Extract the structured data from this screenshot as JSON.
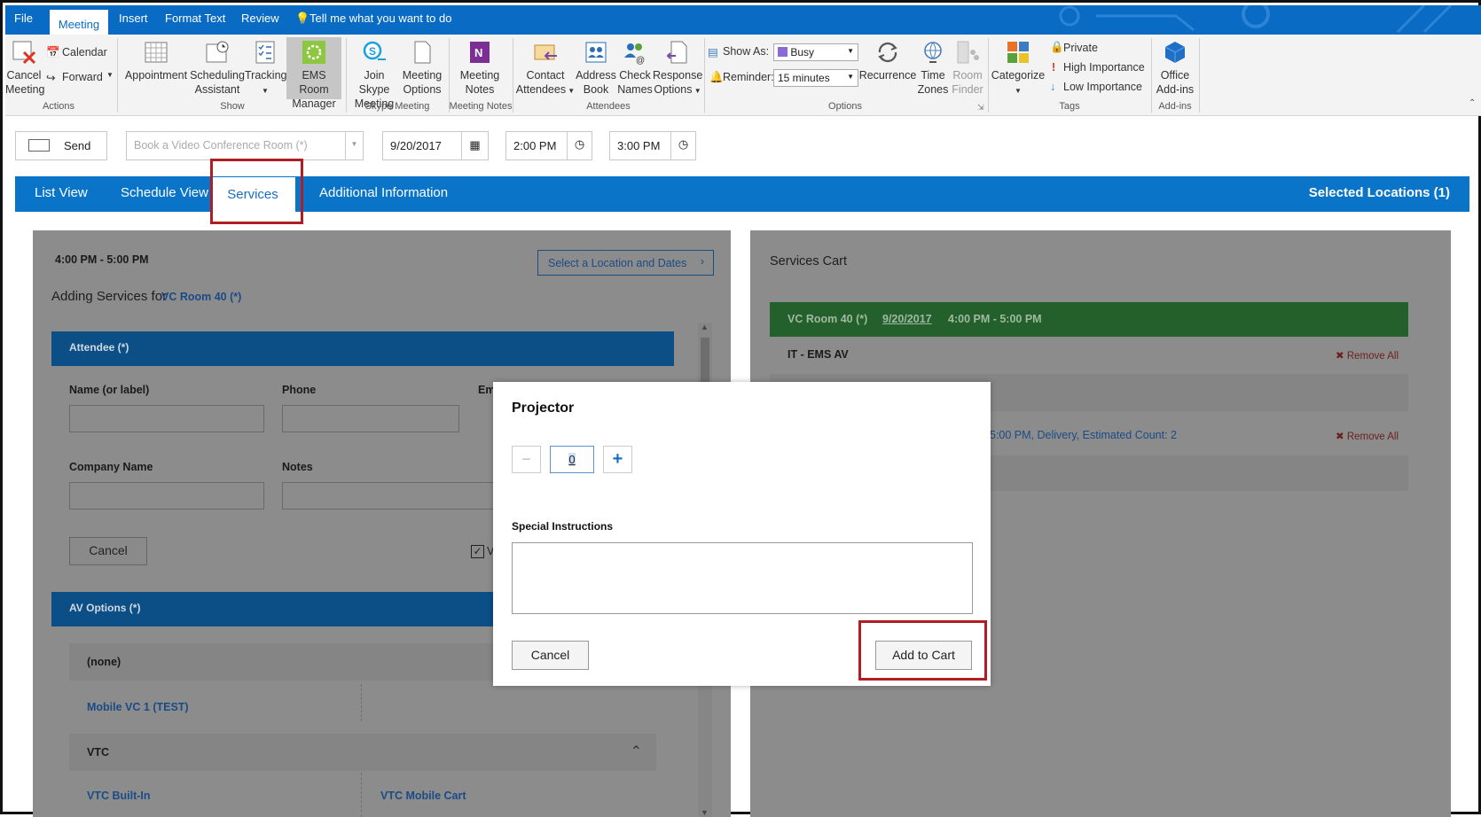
{
  "menu": {
    "tabs": [
      "File",
      "Meeting",
      "Insert",
      "Format Text",
      "Review"
    ],
    "tell_me": "Tell me what you want to do"
  },
  "ribbon": {
    "actions": {
      "cancel_1": "Cancel",
      "cancel_2": "Meeting",
      "calendar": "Calendar",
      "forward": "Forward",
      "group": "Actions"
    },
    "show": {
      "appointment": "Appointment",
      "sched_1": "Scheduling",
      "sched_2": "Assistant",
      "tracking": "Tracking",
      "ems_1": "EMS Room",
      "ems_2": "Manager",
      "group": "Show"
    },
    "skype": {
      "join_1": "Join Skype",
      "join_2": "Meeting",
      "opt_1": "Meeting",
      "opt_2": "Options",
      "group": "Skype Meeting"
    },
    "notes": {
      "label_1": "Meeting",
      "label_2": "Notes",
      "group": "Meeting Notes"
    },
    "attendees": {
      "contact_1": "Contact",
      "contact_2": "Attendees",
      "address_1": "Address",
      "address_2": "Book",
      "check_1": "Check",
      "check_2": "Names",
      "response_1": "Response",
      "response_2": "Options",
      "group": "Attendees"
    },
    "options": {
      "show_as_label": "Show As:",
      "show_as_value": "Busy",
      "reminder_label": "Reminder:",
      "reminder_value": "15 minutes",
      "recurrence": "Recurrence",
      "tz_1": "Time",
      "tz_2": "Zones",
      "rf_1": "Room",
      "rf_2": "Finder",
      "group": "Options"
    },
    "tags": {
      "categorize": "Categorize",
      "private": "Private",
      "high": "High Importance",
      "low": "Low Importance",
      "group": "Tags"
    },
    "addins": {
      "label_1": "Office",
      "label_2": "Add-ins",
      "group": "Add-ins"
    }
  },
  "toolbar": {
    "send": "Send",
    "room_placeholder": "Book a Video Conference Room  (*)",
    "date": "9/20/2017",
    "start_time": "2:00 PM",
    "end_time": "3:00 PM"
  },
  "nav": {
    "tabs": [
      "List View",
      "Schedule View",
      "Services",
      "Additional Information"
    ],
    "selected_locations": "Selected Locations (1)"
  },
  "left": {
    "time_range": "4:00 PM - 5:00 PM",
    "select_location": "Select a Location and Dates",
    "adding_prefix": "Adding Services for",
    "room_link": "VC Room 40 (*)",
    "attendee_header": "Attendee (*)",
    "name_label": "Name (or label)",
    "phone_label": "Phone",
    "email_label": "Em",
    "company_label": "Company Name",
    "notes_label": "Notes",
    "cancel": "Cancel",
    "check_label": "V",
    "av_header": "AV Options (*)",
    "none_option": "(none)",
    "mobile_vc": "Mobile VC 1 (TEST)",
    "vtc": "VTC",
    "vtc_builtin": "VTC Built-In",
    "vtc_mobile": "VTC Mobile Cart"
  },
  "cart": {
    "title": "Services Cart",
    "room": "VC Room 40 (*)",
    "date": "9/20/2017",
    "time": "4:00 PM - 5:00 PM",
    "category": "IT - EMS AV",
    "remove_all": "Remove All",
    "item_line": "5:00 PM, Delivery, Estimated Count: 2"
  },
  "modal": {
    "title": "Projector",
    "quantity": "0",
    "special_label": "Special Instructions",
    "special_value": "",
    "cancel": "Cancel",
    "add_to_cart": "Add to Cart"
  },
  "colors": {
    "ribbon_blue": "#0a6bc4",
    "nav_blue": "#0a74c8",
    "cart_green": "#2e8b3a",
    "highlight_red": "#b01e25"
  }
}
